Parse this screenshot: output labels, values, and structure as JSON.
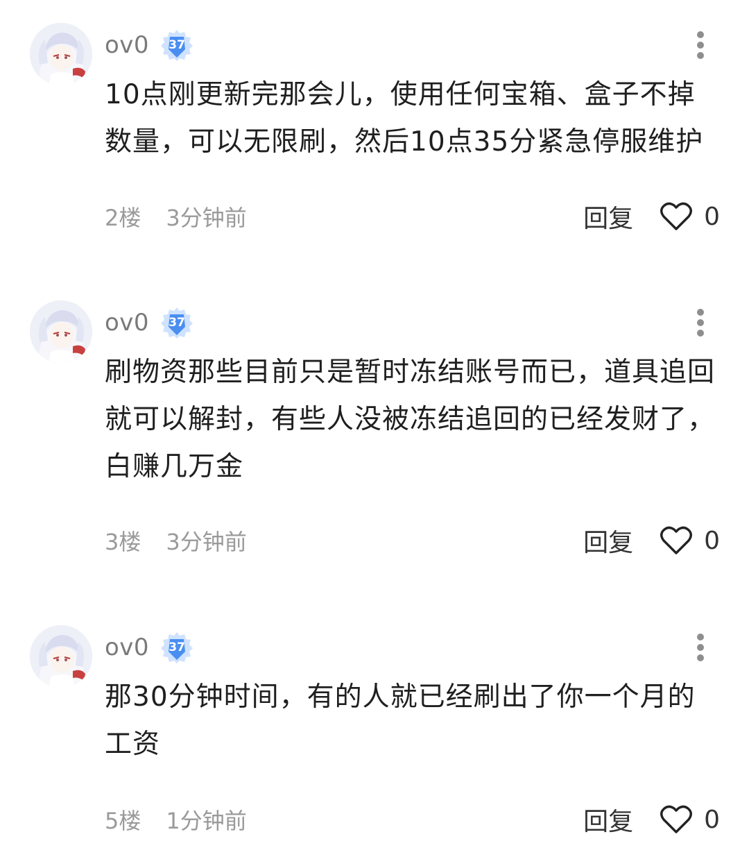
{
  "comments": [
    {
      "username": "ov0",
      "level": "37",
      "content": "10点刚更新完那会儿，使用任何宝箱、盒子不掉数量，可以无限刷，然后10点35分紧急停服维护",
      "floor": "2楼",
      "time": "3分钟前",
      "reply_label": "回复",
      "likes": "0"
    },
    {
      "username": "ov0",
      "level": "37",
      "content": "刷物资那些目前只是暂时冻结账号而已，道具追回就可以解封，有些人没被冻结追回的已经发财了，白赚几万金",
      "floor": "3楼",
      "time": "3分钟前",
      "reply_label": "回复",
      "likes": "0"
    },
    {
      "username": "ov0",
      "level": "37",
      "content": "那30分钟时间，有的人就已经刷出了你一个月的工资",
      "floor": "5楼",
      "time": "1分钟前",
      "reply_label": "回复",
      "likes": "0"
    }
  ],
  "icons": {
    "more": "more-vertical-icon",
    "like": "heart-outline-icon",
    "badge": "level-shield-icon"
  },
  "colors": {
    "badge_blue": "#4a8ef0",
    "badge_light": "#cfe2ff",
    "text_main": "#1f1f1f",
    "text_meta": "#9a9a9a"
  }
}
